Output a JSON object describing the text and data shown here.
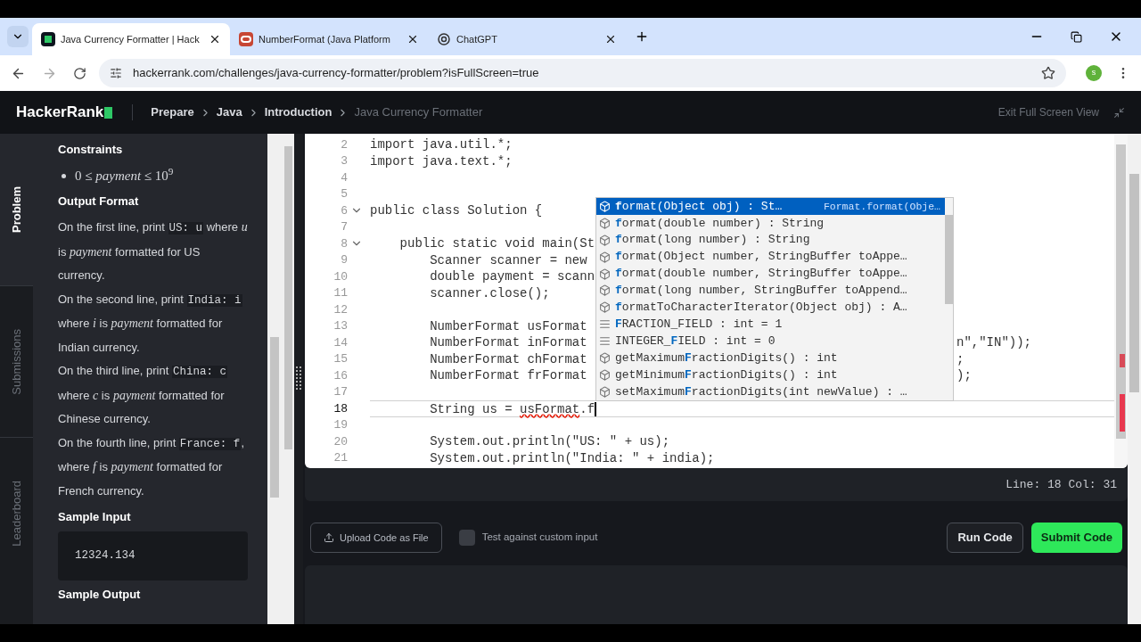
{
  "browser": {
    "tabs": [
      {
        "title": "Java Currency Formatter | Hack",
        "selected": true
      },
      {
        "title": "NumberFormat (Java Platform",
        "selected": false
      },
      {
        "title": "ChatGPT",
        "selected": false
      }
    ],
    "url": "hackerrank.com/challenges/java-currency-formatter/problem?isFullScreen=true",
    "profile": "s"
  },
  "header": {
    "logo": "HackerRank",
    "breadcrumb": [
      {
        "label": "Prepare",
        "current": false
      },
      {
        "label": "Java",
        "current": false
      },
      {
        "label": "Introduction",
        "current": false
      },
      {
        "label": "Java Currency Formatter",
        "current": true
      }
    ],
    "exit": "Exit Full Screen View"
  },
  "side_tabs": [
    {
      "label": "Problem",
      "selected": true
    },
    {
      "label": "Submissions",
      "selected": false
    },
    {
      "label": "Leaderboard",
      "selected": false
    }
  ],
  "problem": {
    "blocks": [
      {
        "kind": "heading",
        "text": "Constraints"
      },
      {
        "kind": "bullet",
        "text": "0 ≤ *payment* ≤ 10$^{9}$"
      },
      {
        "kind": "heading",
        "text": "Output Format"
      },
      {
        "kind": "paragraph",
        "parts": [
          {
            "kind": "text",
            "text": "On the first line, print "
          },
          {
            "kind": "code",
            "text": "US: u"
          },
          {
            "kind": "text",
            "text": " where *u* is *payment* formatted for US currency."
          }
        ]
      },
      {
        "kind": "paragraph",
        "parts": [
          {
            "kind": "text",
            "text": "On the second line, print "
          },
          {
            "kind": "code",
            "text": "India: i"
          },
          {
            "kind": "text",
            "text": " where *i* is *payment* formatted for Indian currency."
          }
        ]
      },
      {
        "kind": "paragraph",
        "parts": [
          {
            "kind": "text",
            "text": "On the third line, print "
          },
          {
            "kind": "code",
            "text": "China: c"
          },
          {
            "kind": "text",
            "text": " where *c* is *payment* formatted for Chinese currency."
          }
        ]
      },
      {
        "kind": "paragraph",
        "parts": [
          {
            "kind": "text",
            "text": "On the fourth line, print "
          },
          {
            "kind": "code",
            "text": "France: f"
          },
          {
            "kind": "text",
            "text": ", where *f* is *payment* formatted for French currency."
          }
        ]
      },
      {
        "kind": "heading",
        "text": "Sample Input"
      },
      {
        "kind": "code",
        "text": "12324.134"
      },
      {
        "kind": "heading",
        "text": "Sample Output"
      }
    ]
  },
  "editor": {
    "lines": [
      {
        "number": "2",
        "text": "import java.util.*;"
      },
      {
        "number": "3",
        "text": "import java.text.*;"
      },
      {
        "number": "4"
      },
      {
        "number": "5"
      },
      {
        "number": "6",
        "text": "public class Solution {",
        "fold": true
      },
      {
        "number": "7"
      },
      {
        "number": "8",
        "text": "    public static void main(St",
        "fold": true
      },
      {
        "number": "9",
        "text": "        Scanner scanner = new"
      },
      {
        "number": "10",
        "text": "        double payment = scann"
      },
      {
        "number": "11",
        "text": "        scanner.close();"
      },
      {
        "number": "12"
      },
      {
        "number": "13",
        "text": "        NumberFormat usFormat"
      },
      {
        "number": "14",
        "text": "        NumberFormat inFormat",
        "tail": "n\",\"IN\"));"
      },
      {
        "number": "15",
        "text": "        NumberFormat chFormat",
        "tail": ";"
      },
      {
        "number": "16",
        "text": "        NumberFormat frFormat",
        "tail": ");"
      },
      {
        "number": "17"
      },
      {
        "number": "18",
        "current": true,
        "parts": [
          {
            "kind": "plain",
            "text": "        String us = "
          },
          {
            "kind": "error",
            "text": "usFormat"
          },
          {
            "kind": "plain",
            "text": ".f"
          }
        ]
      },
      {
        "number": "19"
      },
      {
        "number": "20",
        "text": "        System.out.println(\"US: \" + us);"
      },
      {
        "number": "21",
        "text": "        System.out.println(\"India: \" + india);"
      }
    ],
    "autocomplete": [
      {
        "kind": "method",
        "text": "**f**ormat(Object obj) : St…",
        "detail": "Format.format(Obje…",
        "selected": true
      },
      {
        "kind": "method",
        "text": "**f**ormat(double number) : String",
        "selected": false
      },
      {
        "kind": "method",
        "text": "**f**ormat(long number) : String",
        "selected": false
      },
      {
        "kind": "method",
        "text": "**f**ormat(Object number, StringBuffer toAppe…",
        "selected": false
      },
      {
        "kind": "method",
        "text": "**f**ormat(double number, StringBuffer toAppe…",
        "selected": false
      },
      {
        "kind": "method",
        "text": "**f**ormat(long number, StringBuffer toAppend…",
        "selected": false
      },
      {
        "kind": "method",
        "text": "**f**ormatToCharacterIterator(Object obj) : A…",
        "selected": false
      },
      {
        "kind": "field",
        "text": "**F**RACTION_FIELD : int = 1",
        "selected": false
      },
      {
        "kind": "field",
        "text": "INTEGER_**F**IELD : int = 0",
        "selected": false
      },
      {
        "kind": "method",
        "text": "getMaximum**F**ractionDigits() : int",
        "selected": false
      },
      {
        "kind": "method",
        "text": "getMinimum**F**ractionDigits() : int",
        "selected": false
      },
      {
        "kind": "method",
        "text": "setMaximum**F**ractionDigits(int newValue) : …",
        "selected": false
      }
    ],
    "status": "Line: 18 Col: 31"
  },
  "actions": {
    "upload": "Upload Code as File",
    "custom_input": {
      "label": "Test against custom input",
      "checked": false
    },
    "run": "Run Code",
    "submit": "Submit Code"
  }
}
